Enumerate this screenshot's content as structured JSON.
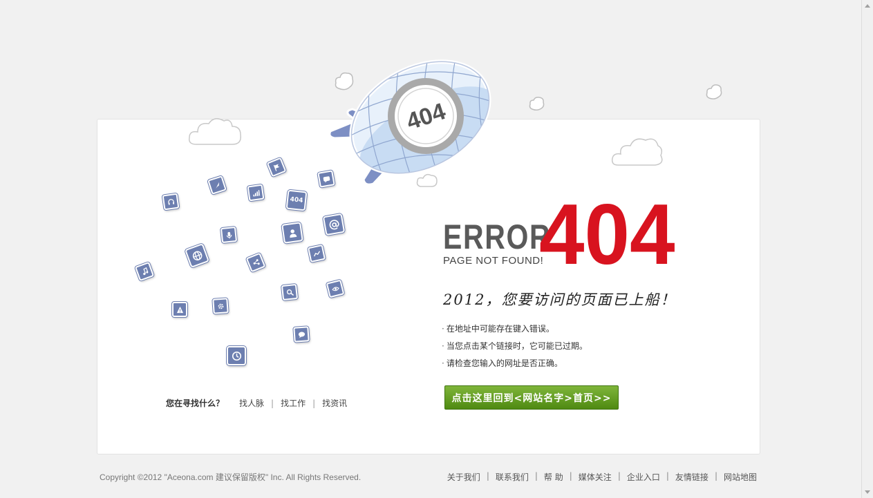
{
  "error": {
    "word": "ERROR",
    "code": "404",
    "subtitle": "PAGE NOT FOUND!",
    "headline": "2012，您要访问的页面已上船！",
    "airship_label": "404",
    "tile_label": "404"
  },
  "tips": [
    "在地址中可能存在键入错误。",
    "当您点击某个链接时，它可能已过期。",
    "请检查您输入的网址是否正确。"
  ],
  "home_button": {
    "label": "点击这里回到<网站名字>首页>>"
  },
  "search": {
    "question": "您在寻找什么？",
    "links": [
      "找人脉",
      "找工作",
      "找资讯"
    ]
  },
  "footer": {
    "copyright": "Copyright ©2012 \"Aceona.com 建议保留版权\" Inc. All Rights Reserved.",
    "links": [
      "关于我们",
      "联系我们",
      "帮 助",
      "媒体关注",
      "企业入口",
      "友情链接",
      "网站地图"
    ]
  },
  "colors": {
    "accent_red": "#d8131f",
    "button_green": "#5f9a1e",
    "tile_blue": "#6d7fb0",
    "page_bg": "#f1f1f1"
  },
  "icons": [
    "headphones-icon",
    "rocket-icon",
    "flag-icon",
    "signal-icon",
    "chat-icon",
    "mic-icon",
    "contact-card-icon",
    "at-sign-icon",
    "globe-icon",
    "share-icon",
    "trend-icon",
    "music-icon",
    "search-icon",
    "eye-icon",
    "warning-icon",
    "settings-icon",
    "speech-bubble-icon",
    "clock-icon"
  ]
}
